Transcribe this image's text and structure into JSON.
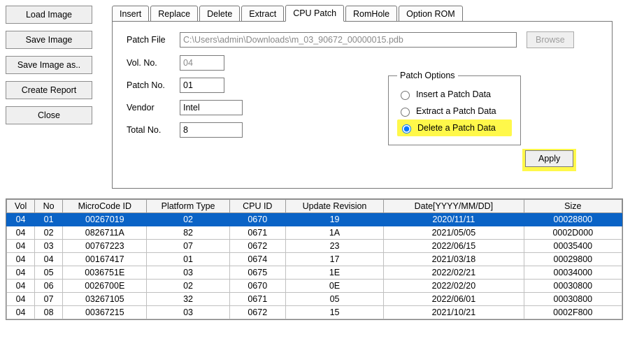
{
  "left_buttons": {
    "load_image": "Load Image",
    "save_image": "Save Image",
    "save_image_as": "Save Image as..",
    "create_report": "Create Report",
    "close": "Close"
  },
  "tabs": {
    "insert": "Insert",
    "replace": "Replace",
    "delete": "Delete",
    "extract": "Extract",
    "cpu_patch": "CPU Patch",
    "romhole": "RomHole",
    "option_rom": "Option ROM"
  },
  "form": {
    "patch_file_label": "Patch File",
    "patch_file_value": "C:\\Users\\admin\\Downloads\\m_03_90672_00000015.pdb",
    "browse_label": "Browse",
    "vol_no_label": "Vol. No.",
    "vol_no_value": "04",
    "patch_no_label": "Patch No.",
    "patch_no_value": "01",
    "vendor_label": "Vendor",
    "vendor_value": "Intel",
    "total_no_label": "Total No.",
    "total_no_value": "8"
  },
  "patch_options": {
    "legend": "Patch Options",
    "insert": "Insert a Patch Data",
    "extract": "Extract a Patch Data",
    "delete": "Delete a Patch Data"
  },
  "apply_label": "Apply",
  "table_headers": {
    "vol": "Vol",
    "no": "No",
    "microcode_id": "MicroCode ID",
    "platform_type": "Platform Type",
    "cpu_id": "CPU ID",
    "update_revision": "Update Revision",
    "date": "Date[YYYY/MM/DD]",
    "size": "Size"
  },
  "rows": [
    {
      "vol": "04",
      "no": "01",
      "mc": "00267019",
      "pt": "02",
      "cpu": "0670",
      "upd": "19",
      "date": "2020/11/11",
      "size": "00028800",
      "sel": true
    },
    {
      "vol": "04",
      "no": "02",
      "mc": "0826711A",
      "pt": "82",
      "cpu": "0671",
      "upd": "1A",
      "date": "2021/05/05",
      "size": "0002D000"
    },
    {
      "vol": "04",
      "no": "03",
      "mc": "00767223",
      "pt": "07",
      "cpu": "0672",
      "upd": "23",
      "date": "2022/06/15",
      "size": "00035400"
    },
    {
      "vol": "04",
      "no": "04",
      "mc": "00167417",
      "pt": "01",
      "cpu": "0674",
      "upd": "17",
      "date": "2021/03/18",
      "size": "00029800"
    },
    {
      "vol": "04",
      "no": "05",
      "mc": "0036751E",
      "pt": "03",
      "cpu": "0675",
      "upd": "1E",
      "date": "2022/02/21",
      "size": "00034000"
    },
    {
      "vol": "04",
      "no": "06",
      "mc": "0026700E",
      "pt": "02",
      "cpu": "0670",
      "upd": "0E",
      "date": "2022/02/20",
      "size": "00030800"
    },
    {
      "vol": "04",
      "no": "07",
      "mc": "03267105",
      "pt": "32",
      "cpu": "0671",
      "upd": "05",
      "date": "2022/06/01",
      "size": "00030800"
    },
    {
      "vol": "04",
      "no": "08",
      "mc": "00367215",
      "pt": "03",
      "cpu": "0672",
      "upd": "15",
      "date": "2021/10/21",
      "size": "0002F800"
    }
  ]
}
